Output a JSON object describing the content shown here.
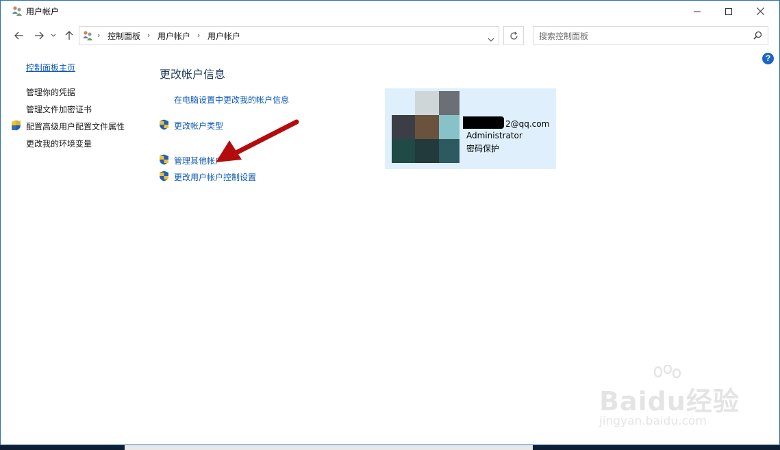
{
  "window": {
    "title": "用户帐户"
  },
  "address": {
    "crumbs": [
      "控制面板",
      "用户帐户",
      "用户帐户"
    ]
  },
  "search": {
    "placeholder": "搜索控制面板"
  },
  "help": {
    "label": "?"
  },
  "sidebar": {
    "home": "控制面板主页",
    "items": [
      "管理你的凭据",
      "管理文件加密证书",
      "配置高级用户配置文件属性",
      "更改我的环境变量"
    ]
  },
  "main": {
    "heading": "更改帐户信息",
    "tasks": [
      "在电脑设置中更改我的帐户信息",
      "更改帐户类型",
      "管理其他帐户",
      "更改用户帐户控制设置"
    ]
  },
  "account": {
    "email": "2@qq.com",
    "type": "Administrator",
    "status": "密码保护"
  },
  "watermark": {
    "brand": "Baidu经验",
    "url": "jingyan.baidu.com"
  },
  "colors": {
    "link": "#0b58b8",
    "heading": "#1e395b",
    "tile": "#dff0fc",
    "arrow": "#b40c0c"
  }
}
